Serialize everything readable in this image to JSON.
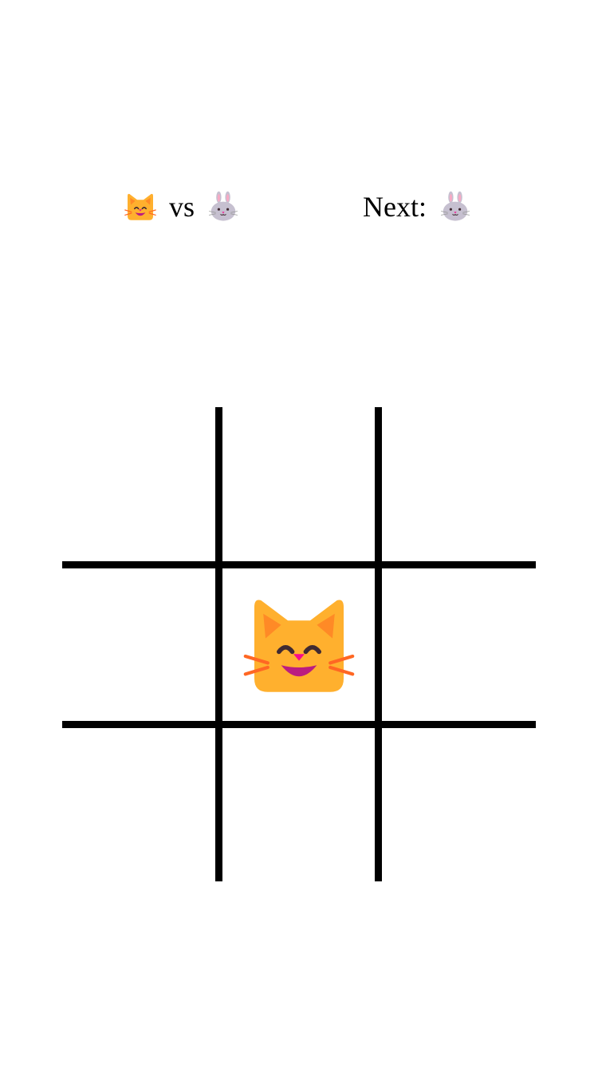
{
  "header": {
    "player1_icon": "grinning-cat-icon",
    "vs_text": "vs",
    "player2_icon": "rabbit-face-icon",
    "next_label": "Next:",
    "next_icon": "rabbit-face-icon"
  },
  "board": {
    "cells": [
      "",
      "",
      "",
      "",
      "grinning-cat-icon",
      "",
      "",
      "",
      ""
    ]
  },
  "colors": {
    "grid_line": "#000000",
    "background": "#ffffff",
    "cat_body": "#FFB02E",
    "rabbit_body": "#C6C0D0"
  }
}
